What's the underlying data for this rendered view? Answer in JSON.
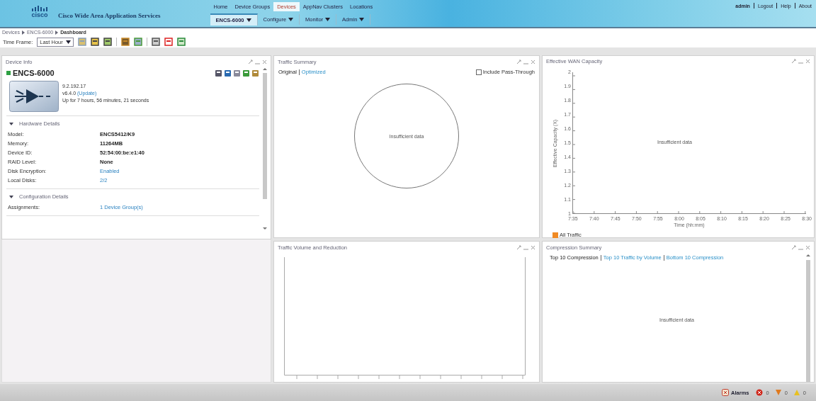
{
  "header": {
    "logo": "cisco",
    "product": "Cisco Wide Area Application Services",
    "nav_tabs": [
      {
        "label": "Home",
        "selected": false
      },
      {
        "label": "Device Groups",
        "selected": false
      },
      {
        "label": "Devices",
        "selected": true
      },
      {
        "label": "AppNav Clusters",
        "selected": false
      },
      {
        "label": "Locations",
        "selected": false
      }
    ],
    "sub_menus": [
      {
        "label": "ENCS-6000",
        "selected": true
      },
      {
        "label": "Configure",
        "selected": false
      },
      {
        "label": "Monitor",
        "selected": false
      },
      {
        "label": "Admin",
        "selected": false
      }
    ],
    "user_links": [
      "admin",
      "Logout",
      "Help",
      "About"
    ]
  },
  "breadcrumb": [
    "Devices",
    "ENCS-6000",
    "Dashboard"
  ],
  "toolbar": {
    "time_frame_label": "Time Frame:",
    "time_frame_value": "Last Hour"
  },
  "device_info": {
    "title": "Device Info",
    "device_name": "ENCS-6000",
    "online": true,
    "ip": "9.2.192.17",
    "version": "v6.4.0",
    "version_link": "(Update)",
    "uptime": "Up for 7 hours, 56 minutes, 21 seconds",
    "sections": [
      {
        "title": "Hardware Details",
        "expanded": true,
        "rows": [
          {
            "label": "Model:",
            "value": "ENCS5412/K9",
            "link": false
          },
          {
            "label": "Memory:",
            "value": "11264MB",
            "link": false
          },
          {
            "label": "Device ID:",
            "value": "52:54:00:be:e1:40",
            "link": false
          },
          {
            "label": "RAID Level:",
            "value": "None",
            "link": false
          },
          {
            "label": "Disk Encryption:",
            "value": "Enabled",
            "link": true
          },
          {
            "label": "Local Disks:",
            "value": "2/2",
            "link": true
          }
        ]
      },
      {
        "title": "Configuration Details",
        "expanded": true,
        "rows": [
          {
            "label": "Assignments:",
            "value": "1 Device Group(s)",
            "link": true
          }
        ]
      }
    ]
  },
  "traffic_summary": {
    "title": "Traffic Summary",
    "tabs": [
      {
        "label": "Original",
        "selected": true
      },
      {
        "label": "Optimized",
        "selected": false
      }
    ],
    "pass_through": {
      "label": "Include Pass-Through",
      "checked": false
    },
    "message": "Insufficient data"
  },
  "wan_capacity": {
    "title": "Effective WAN Capacity",
    "message": "Insufficient data",
    "ylabel": "Effective Capacity (X)",
    "xlabel": "Time (hh:mm)",
    "y_ticks": [
      "2",
      "1.9",
      "1.8",
      "1.7",
      "1.6",
      "1.5",
      "1.4",
      "1.3",
      "1.2",
      "1.1",
      "1"
    ],
    "x_ticks": [
      "7:35",
      "7:40",
      "7:45",
      "7:50",
      "7:55",
      "8:00",
      "8:05",
      "8:10",
      "8:15",
      "8:20",
      "8:25",
      "8:30"
    ],
    "legend": [
      {
        "label": "All Traffic",
        "color": "#f08a24"
      }
    ]
  },
  "traffic_volume": {
    "title": "Traffic Volume and Reduction"
  },
  "compression": {
    "title": "Compression Summary",
    "tabs": [
      {
        "label": "Top 10 Compression",
        "selected": true
      },
      {
        "label": "Top 10 Traffic by Volume",
        "selected": false
      },
      {
        "label": "Bottom 10 Compression",
        "selected": false
      }
    ],
    "message": "Insufficient data"
  },
  "status_bar": {
    "alarms_label": "Alarms",
    "counts": [
      {
        "kind": "critical",
        "value": "0"
      },
      {
        "kind": "major",
        "value": "0"
      },
      {
        "kind": "minor",
        "value": "0"
      }
    ]
  }
}
